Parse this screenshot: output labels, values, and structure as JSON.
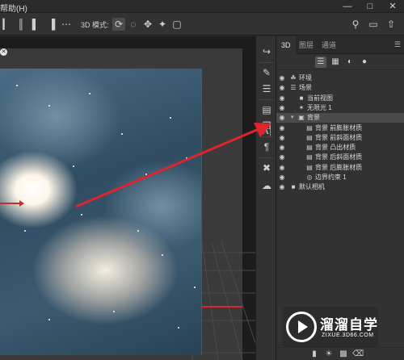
{
  "menubar": {
    "help_menu": "帮助(H)"
  },
  "optbar": {
    "mode_label": "3D 模式:"
  },
  "panel": {
    "tabs": [
      {
        "label": "3D",
        "active": true
      },
      {
        "label": "图层",
        "active": false
      },
      {
        "label": "通道",
        "active": false
      }
    ],
    "layers": [
      {
        "label": "环境",
        "icon": "environment-icon",
        "indent": 0,
        "caret": "",
        "selected": false
      },
      {
        "label": "场景",
        "icon": "scene-icon",
        "indent": 0,
        "caret": "",
        "selected": false
      },
      {
        "label": "当前视图",
        "icon": "camera-icon",
        "indent": 1,
        "caret": "",
        "selected": false
      },
      {
        "label": "无限光 1",
        "icon": "light-icon",
        "indent": 1,
        "caret": "",
        "selected": false
      },
      {
        "label": "背景",
        "icon": "mesh-icon",
        "indent": 1,
        "caret": "v",
        "selected": true
      },
      {
        "label": "背景 前膨胀材质",
        "icon": "material-icon",
        "indent": 2,
        "caret": "",
        "selected": false
      },
      {
        "label": "背景 前斜面材质",
        "icon": "material-icon",
        "indent": 2,
        "caret": "",
        "selected": false
      },
      {
        "label": "背景 凸出材质",
        "icon": "material-icon",
        "indent": 2,
        "caret": "",
        "selected": false
      },
      {
        "label": "背景 后斜面材质",
        "icon": "material-icon",
        "indent": 2,
        "caret": "",
        "selected": false
      },
      {
        "label": "背景 后膨胀材质",
        "icon": "material-icon",
        "indent": 2,
        "caret": "",
        "selected": false
      },
      {
        "label": "边界约束 1",
        "icon": "constraint-icon",
        "indent": 2,
        "caret": "",
        "selected": false
      },
      {
        "label": "默认相机",
        "icon": "default-camera-icon",
        "indent": 0,
        "caret": "",
        "selected": false
      }
    ]
  },
  "watermark": {
    "title": "溜溜自学",
    "subtitle": "ZIXUE.3D66.COM"
  },
  "colors": {
    "arrow": "#e0242a",
    "panel_bg": "#323232",
    "selected_row": "#4a4a4a"
  }
}
